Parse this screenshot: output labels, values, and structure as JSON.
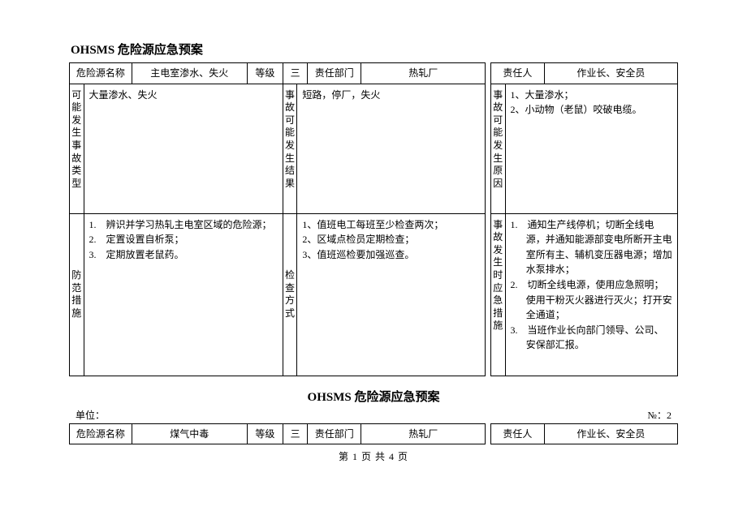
{
  "title1": "OHSMS 危险源应急预案",
  "header1": {
    "name_label": "危险源名称",
    "name_value": "主电室渗水、失火",
    "grade_label": "等级",
    "grade_value": "三",
    "dept_label": "责任部门",
    "dept_value": "热轧厂",
    "resp_label": "责任人",
    "resp_value": "作业长、安全员"
  },
  "row1": {
    "v1_label": "可能发生事故类型",
    "v1_content": "大量渗水、失火",
    "v2_label": "事故可能发生结果",
    "v2_content": "短路，停厂，失火",
    "v3_label": "事故可能发生原因",
    "v3_lines": [
      "1、大量渗水；",
      "2、小动物（老鼠）咬破电缆。"
    ]
  },
  "row2": {
    "v1_label": "防范措施",
    "v1_items": [
      "1.　辨识并学习热轧主电室区域的危险源；",
      "2.　定置设置自析泵；",
      "3.　定期放置老鼠药。"
    ],
    "v2_label": "检查方式",
    "v2_lines": [
      "1、值班电工每班至少检查两次；",
      "2、区域点检员定期检查；",
      "3、值班巡检要加强巡查。"
    ],
    "v3_label": "事故发生时应急措施",
    "v3_items": [
      "1.　通知生产线停机；切断全线电源，并通知能源部变电所断开主电室所有主、辅机变压器电源；增加水泵排水；",
      "2.　切断全线电源，使用应急照明；使用干粉灭火器进行灭火；打开安全通道；",
      "3.　当班作业长向部门领导、公司、安保部汇报。"
    ]
  },
  "title2": "OHSMS 危险源应急预案",
  "meta2": {
    "unit_label": "单位：",
    "no_label": "№：",
    "no_value": "2"
  },
  "header2": {
    "name_label": "危险源名称",
    "name_value": "煤气中毒",
    "grade_label": "等级",
    "grade_value": "三",
    "dept_label": "责任部门",
    "dept_value": "热轧厂",
    "resp_label": "责任人",
    "resp_value": "作业长、安全员"
  },
  "footer": "第 1 页 共 4 页"
}
